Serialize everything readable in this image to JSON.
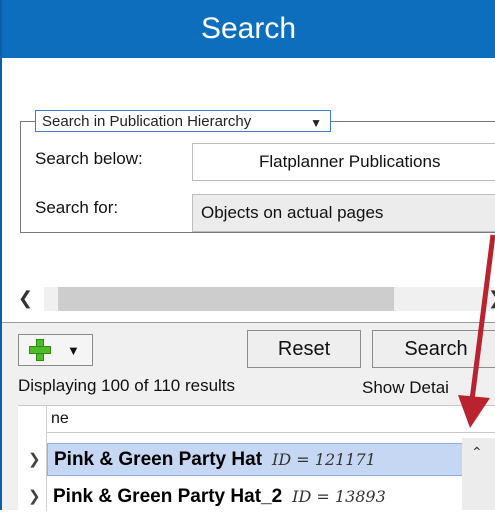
{
  "window": {
    "title": "Search"
  },
  "scope": {
    "selected": "Search in Publication Hierarchy"
  },
  "form": {
    "search_below_label": "Search below:",
    "search_below_value": "Flatplanner Publications",
    "search_for_label": "Search for:",
    "search_for_value": "Objects on actual pages"
  },
  "toolbar": {
    "reset_label": "Reset",
    "search_label": "Search"
  },
  "status": {
    "text": "Displaying 100 of 110 results"
  },
  "show_details_label": "Show Detai",
  "grid": {
    "column_header": "ne",
    "rows": [
      {
        "name": "Pink & Green Party Hat",
        "id": "ID = 121171",
        "selected": true
      },
      {
        "name": "Pink & Green Party Hat_2",
        "id": "ID = 13893",
        "selected": false
      }
    ]
  },
  "colors": {
    "titlebar": "#0d6ebd",
    "selection": "#c5d7f3",
    "annotation_arrow": "#b8232f"
  },
  "icons": {
    "add": "green-plus-icon",
    "dropdown": "triangle-down-icon",
    "expand": "chevron-right-icon",
    "scroll_left": "chevron-left-icon",
    "scroll_up": "chevron-up-icon"
  }
}
